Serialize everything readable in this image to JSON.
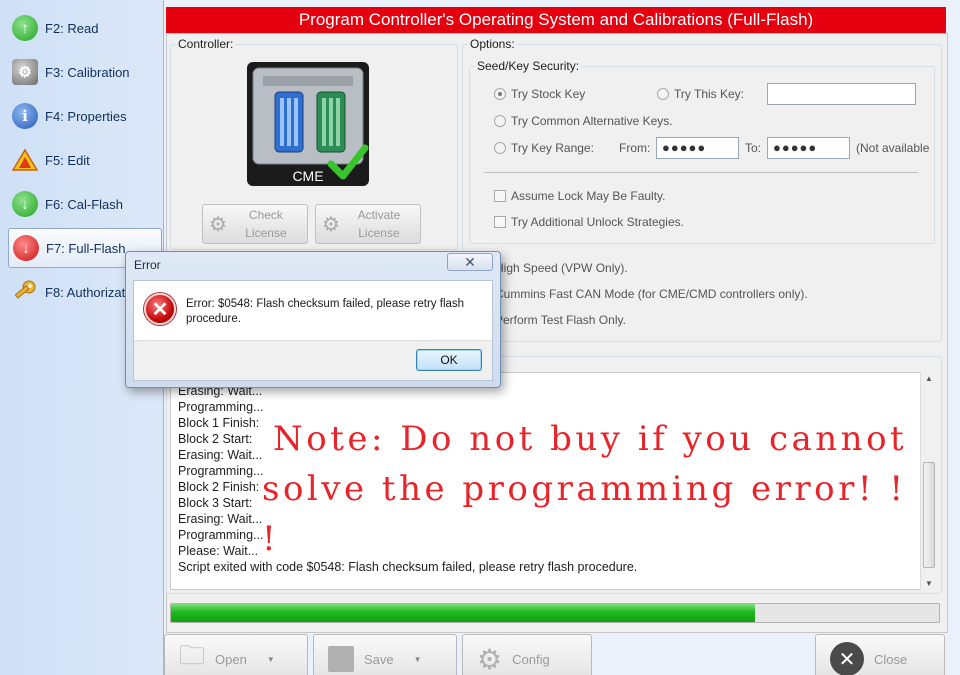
{
  "sidebar": {
    "items": [
      {
        "label": "F2: Read",
        "icon": "green-arrow-up-icon"
      },
      {
        "label": "F3: Calibration",
        "icon": "wrench-gear-icon"
      },
      {
        "label": "F4: Properties",
        "icon": "info-icon"
      },
      {
        "label": "F5: Edit",
        "icon": "warning-triangle-icon"
      },
      {
        "label": "F6: Cal-Flash",
        "icon": "green-arrow-down-icon"
      },
      {
        "label": "F7: Full-Flash",
        "icon": "red-arrow-down-icon",
        "active": true
      },
      {
        "label": "F8: Authorizati",
        "icon": "key-icon"
      }
    ]
  },
  "header": {
    "title": "Program Controller's Operating System and Calibrations (Full-Flash)"
  },
  "controller": {
    "group_label": "Controller:",
    "module_label": "CME",
    "check_license": [
      "Check",
      "License"
    ],
    "activate_license": [
      "Activate",
      "License"
    ]
  },
  "options": {
    "group_label": "Options:",
    "seed_key": {
      "group_label": "Seed/Key Security:",
      "try_stock_key": "Try Stock Key",
      "try_this_key": "Try This Key:",
      "try_this_key_value": "",
      "try_common_keys": "Try Common Alternative Keys.",
      "try_key_range": "Try Key Range:",
      "from_label": "From:",
      "from_value": "●●●●●",
      "to_label": "To:",
      "to_value": "●●●●●",
      "not_available": "(Not available",
      "assume_lock": "Assume Lock May Be Faulty.",
      "try_unlock": "Try Additional Unlock Strategies."
    },
    "high_speed": "High Speed (VPW Only).",
    "cummins_can": "Cummins Fast CAN Mode (for CME/CMD controllers only).",
    "test_flash": "Perform Test Flash Only."
  },
  "log": {
    "lines": [
      "Erasing: Wait...",
      "Programming...",
      "Block 1 Finish:",
      "Block 2 Start:",
      "Erasing: Wait...",
      "Programming...",
      "Block 2 Finish:",
      "Block 3 Start:",
      "Erasing: Wait...",
      "Programming...",
      "Please: Wait...",
      "Script exited with code $0548: Flash checksum failed, please retry flash procedure."
    ]
  },
  "progress": {
    "fraction": 0.76,
    "color": "#1fb91f"
  },
  "bottom": {
    "open": "Open",
    "save": "Save",
    "config": "Config",
    "close": "Close"
  },
  "note": {
    "line1": "Note: Do not buy if you cannot",
    "line2": "solve the programming error! ! !"
  },
  "dialog": {
    "title": "Error",
    "message": "Error: $0548: Flash checksum failed, please retry flash procedure.",
    "ok": "OK"
  },
  "colors": {
    "title_bar": "#e4000f",
    "note": "#e8242a",
    "accent": "#3c7fb1"
  }
}
